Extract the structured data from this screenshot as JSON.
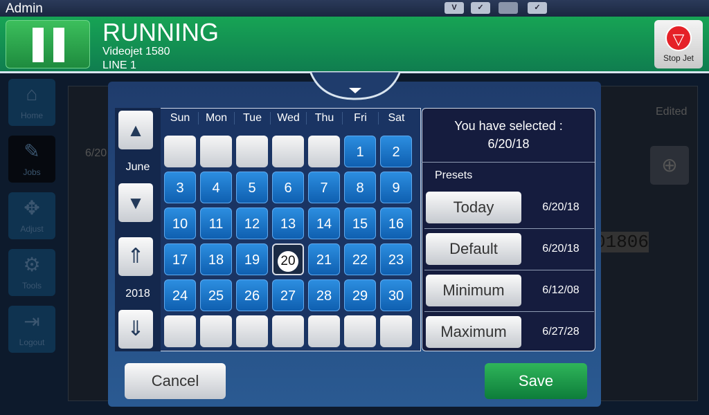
{
  "topbar": {
    "user": "Admin",
    "status_icons": [
      "user-v-icon",
      "check-connection-icon",
      "users-icon",
      "check-grid-icon"
    ]
  },
  "header": {
    "status": "RUNNING",
    "model": "Videojet 1580",
    "line": "LINE 1",
    "stop_label": "Stop Jet"
  },
  "sidebar": [
    {
      "label": "Home",
      "icon": "⌂"
    },
    {
      "label": "Jobs",
      "icon": "✎"
    },
    {
      "label": "Adjust",
      "icon": "✥"
    },
    {
      "label": "Tools",
      "icon": "⚙"
    },
    {
      "label": "Logout",
      "icon": "⇥"
    }
  ],
  "background": {
    "date_field": "6/20",
    "edited_label": "Edited",
    "preview_text": "01806"
  },
  "calendar": {
    "month": "June",
    "year": "2018",
    "weekdays": [
      "Sun",
      "Mon",
      "Tue",
      "Wed",
      "Thu",
      "Fri",
      "Sat"
    ],
    "first_weekday": 5,
    "days": 30,
    "selected_day": 20
  },
  "selection": {
    "label": "You have selected :",
    "value": "6/20/18"
  },
  "presets": {
    "title": "Presets",
    "items": [
      {
        "label": "Today",
        "value": "6/20/18"
      },
      {
        "label": "Default",
        "value": "6/20/18"
      },
      {
        "label": "Minimum",
        "value": "6/12/08"
      },
      {
        "label": "Maximum",
        "value": "6/27/28"
      }
    ]
  },
  "actions": {
    "cancel": "Cancel",
    "save": "Save"
  },
  "colors": {
    "header_green": "#17a455",
    "day_blue": "#1a75c8",
    "stop_red": "#e52128"
  }
}
